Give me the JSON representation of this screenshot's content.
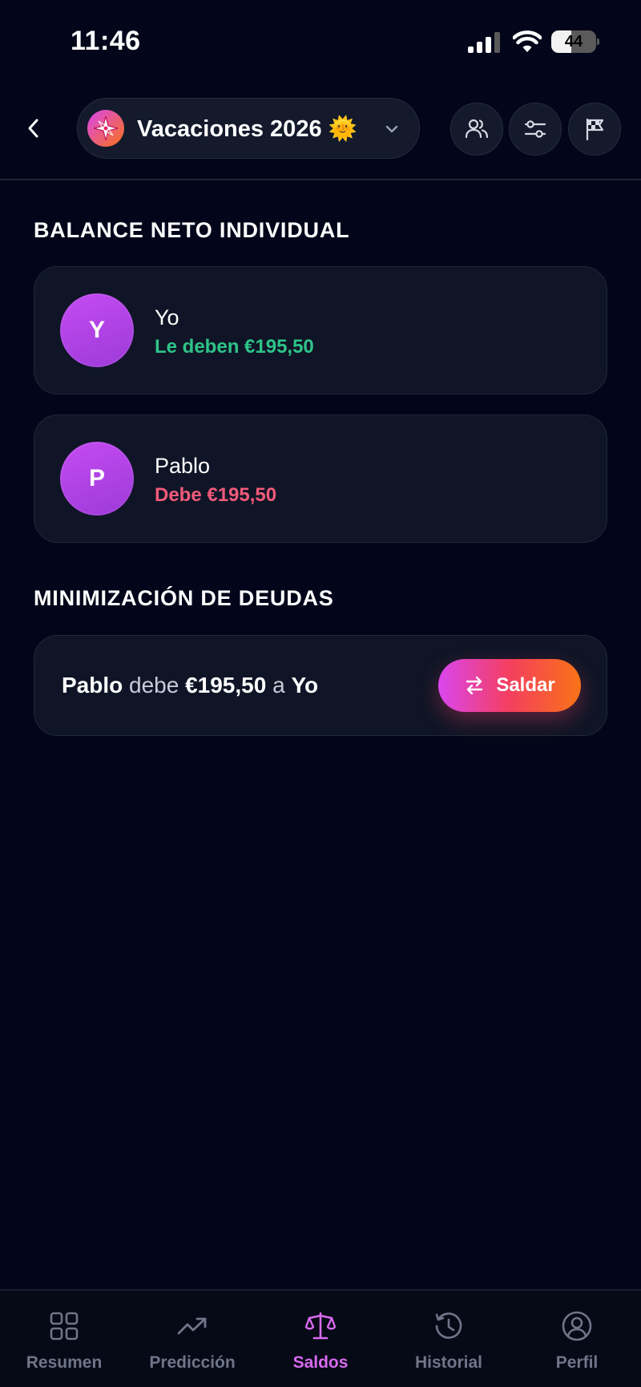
{
  "status_bar": {
    "time": "11:46",
    "battery": "44",
    "battery_level": 0.44
  },
  "header": {
    "trip_name": "Vacaciones 2026 🌞"
  },
  "balance_section": {
    "title": "BALANCE NETO INDIVIDUAL",
    "people": [
      {
        "initial": "Y",
        "name": "Yo",
        "balance": "Le deben €195,50",
        "status": "positive"
      },
      {
        "initial": "P",
        "name": "Pablo",
        "balance": "Debe €195,50",
        "status": "negative"
      }
    ]
  },
  "debts_section": {
    "title": "MINIMIZACIÓN DE DEUDAS",
    "debts": [
      {
        "debtor": "Pablo",
        "verb": "debe",
        "amount": "€195,50",
        "connector": "a",
        "creditor": "Yo",
        "action_label": "Saldar"
      }
    ]
  },
  "nav": {
    "items": [
      {
        "label": "Resumen",
        "icon": "grid-icon"
      },
      {
        "label": "Predicción",
        "icon": "trend-up-icon"
      },
      {
        "label": "Saldos",
        "icon": "scale-icon",
        "active": true
      },
      {
        "label": "Historial",
        "icon": "history-icon"
      },
      {
        "label": "Perfil",
        "icon": "user-circle-icon"
      }
    ]
  },
  "colors": {
    "background": "#03061a",
    "card": "#0f1526",
    "positive": "#2ec488",
    "negative": "#f25a7a",
    "accent": "#d86af0",
    "gradient_start": "#d946ef",
    "gradient_end": "#f97316"
  }
}
